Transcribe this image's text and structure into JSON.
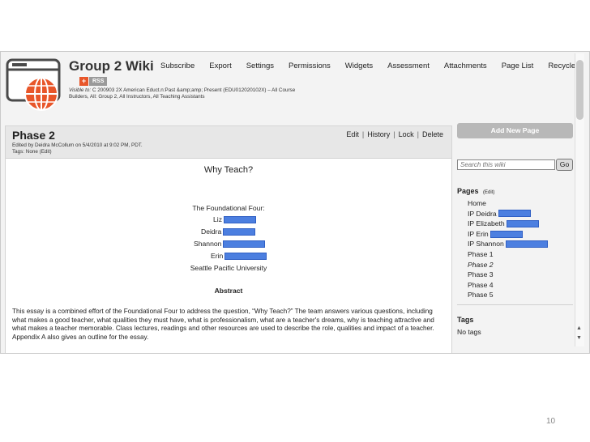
{
  "header": {
    "wiki_title": "Group 2 Wiki",
    "nav": [
      "Subscribe",
      "Export",
      "Settings",
      "Permissions",
      "Widgets",
      "Assessment",
      "Attachments",
      "Page List",
      "Recycle"
    ],
    "rss_label": "RSS",
    "visible_to_label": "Visible to:",
    "visible_to_text": "C 200903 2X American Educt.n:Past &amp;amp; Present (EDU012020102X) – All Course Builders, All: Group 2, All Instructors, All Teaching Assistants"
  },
  "page": {
    "title": "Phase 2",
    "edited_by": "Edited by Deidra McCollum on 5/4/2010 at 9:02 PM, PDT.",
    "tags_line": "Tags: None   (Edit)",
    "actions": [
      "Edit",
      "History",
      "Lock",
      "Delete"
    ]
  },
  "document": {
    "heading": "Why Teach?",
    "authors_heading": "The Foundational Four:",
    "authors": [
      "Liz",
      "Deidra",
      "Shannon",
      "Erin"
    ],
    "university": "Seattle Pacific University",
    "abstract_heading": "Abstract",
    "abstract_text": "This essay is a combined effort of the Foundational Four to address the question, “Why Teach?” The team answers various questions, including what makes a good teacher, what qualities they must have, what is professionalism, what are a teacher's dreams, why is teaching attractive and what makes a teacher memorable. Class lectures, readings and other resources are used to describe the role, qualities and impact of a teacher. Appendix A also gives an outline for the essay."
  },
  "sidebar": {
    "add_page_label": "Add New Page",
    "search_placeholder": "Search this wiki",
    "search_button": "Go",
    "pages_heading": "Pages",
    "pages_edit": "(Edit)",
    "pages": [
      "Home",
      "IP Deidra",
      "IP Elizabeth",
      "IP Erin",
      "IP Shannon",
      "Phase 1",
      "Phase 2",
      "Phase 3",
      "Phase 4",
      "Phase 5"
    ],
    "current_page": "Phase 2",
    "tags_heading": "Tags",
    "tags_value": "No tags"
  },
  "slide_number": "10",
  "colors": {
    "redaction": "#4c7fe0",
    "rss_accent": "#e8562a",
    "logo_accent": "#e8562a"
  }
}
